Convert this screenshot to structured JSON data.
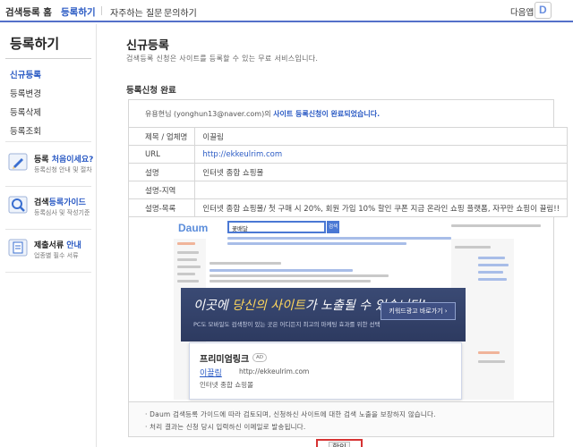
{
  "topnav": {
    "home": "검색등록 홈",
    "register": "등록하기",
    "faq": "자주하는 질문",
    "inquiry": "문의하기",
    "daum_home": "다음앱",
    "daum_logo": "D"
  },
  "sidebar": {
    "title": "등록하기",
    "items": [
      {
        "label": "신규등록",
        "active": true
      },
      {
        "label": "등록변경",
        "active": false
      },
      {
        "label": "등록삭제",
        "active": false
      },
      {
        "label": "등록조회",
        "active": false
      }
    ],
    "promos": [
      {
        "title_normal": "등록 ",
        "title_highlight": "처음이세요?",
        "sub": "등록신청 안내 및 절차",
        "icon": "pencil-icon"
      },
      {
        "title_normal": "검색",
        "title_highlight": "등록가이드",
        "sub": "등록심사 및 작성기준",
        "icon": "magnifier-icon"
      },
      {
        "title_normal": "제출서류 ",
        "title_highlight": "안내",
        "sub": "업종별 필수 서류",
        "icon": "document-icon"
      }
    ]
  },
  "main": {
    "title": "신규등록",
    "description": "검색등록 신청은 사이트를 등록할 수 있는 무료 서비스입니다.",
    "section_title": "등록신청 완료",
    "complete_msg_prefix": "유용현님 (yonghun13@naver.com)의 ",
    "complete_msg_strong": "사이트 등록신청이 완료되었습니다.",
    "rows": [
      {
        "label": "제목 / 업체명",
        "value": "이끌림",
        "link": false
      },
      {
        "label": "URL",
        "value": "http://ekkeulrim.com",
        "link": true
      },
      {
        "label": "설명",
        "value": "인터넷 종합 쇼핑몰",
        "link": false
      },
      {
        "label": "설명-지역",
        "value": "",
        "link": false
      },
      {
        "label": "설명-목록",
        "value": "인터넷 종합 쇼핑몰/ 첫 구매 시 20%, 회원 가입 10% 할인 쿠폰 지금 온라인 쇼핑 플랫폼, 자꾸만 쇼핑이 끌림!!",
        "link": false
      }
    ],
    "preview": {
      "logo": "Daum",
      "search_value": "꽃배달",
      "search_button": "검색",
      "overlay_title_1": "이곳에 ",
      "overlay_title_hl": "당신의 사이트",
      "overlay_title_2": "가 노출될 수 있습니다!",
      "overlay_sub": "PC도 모바일도 검색창이 있는 곳은 어디든지 최고의 마케팅 효과를 위한 선택",
      "overlay_button": "키워드광고 바로가기 ›",
      "ad_title": "프리미엄링크",
      "ad_badge": "AD",
      "ad_name": "이끌림",
      "ad_url": "http://ekkeulrim.com",
      "ad_desc": "인터넷 종합 쇼핑몰"
    },
    "notes": [
      "· Daum 검색등록 가이드에 따라 검토되며, 신청하신 사이트에 대한 검색 노출을 보장하지 않습니다.",
      "· 처리 결과는 신청 당시 입력하신 이메일로 발송됩니다."
    ],
    "confirm_button": "확인"
  },
  "colors": {
    "accent": "#2a5ac4",
    "nav_border": "#5470c9",
    "confirm_highlight": "#d63333"
  }
}
